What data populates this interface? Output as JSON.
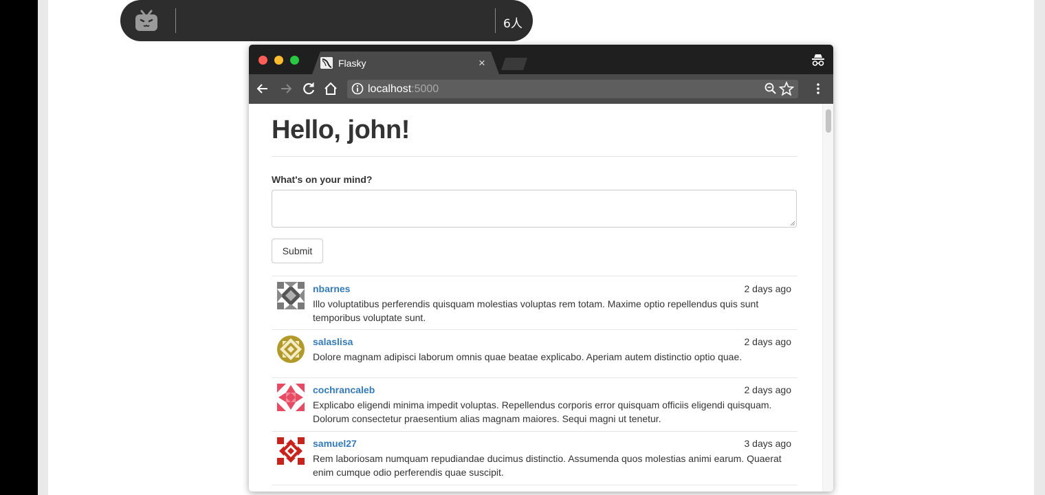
{
  "overlay": {
    "viewer_count": "6人"
  },
  "browser": {
    "tab_title": "Flasky",
    "tab_close": "×",
    "url_host": "localhost",
    "url_port": ":5000"
  },
  "page": {
    "greeting": "Hello, john!",
    "form_label": "What's on your mind?",
    "textarea_value": "",
    "submit_label": "Submit"
  },
  "posts": [
    {
      "author": "nbarnes",
      "date": "2 days ago",
      "body": "Illo voluptatibus perferendis quisquam molestias voluptas rem totam. Maxime optio repellendus quis sunt temporibus voluptate sunt.",
      "avatar_color": "#6b6b6b"
    },
    {
      "author": "salaslisa",
      "date": "2 days ago",
      "body": "Dolore magnam adipisci laborum omnis quae beatae explicabo. Aperiam autem distinctio optio quae.",
      "avatar_color": "#b19a2a"
    },
    {
      "author": "cochrancaleb",
      "date": "2 days ago",
      "body": "Explicabo eligendi minima impedit voluptas. Repellendus corporis error quisquam officiis eligendi quisquam. Dolorum consectetur praesentium alias magnam maiores. Sequi magni ut tenetur.",
      "avatar_color": "#e64b63"
    },
    {
      "author": "samuel27",
      "date": "3 days ago",
      "body": "Rem laboriosam numquam repudiandae ducimus distinctio. Assumenda quos molestias animi earum. Quaerat enim cumque odio perferendis quae suscipit.",
      "avatar_color": "#c8221c"
    }
  ],
  "colors": {
    "link": "#337ab7",
    "titlebar": "#1f1f1f",
    "toolbar": "#4a4a4a",
    "traffic_red": "#ff5f57",
    "traffic_yellow": "#febc2e",
    "traffic_green": "#28c840"
  },
  "icons": [
    "bilibili-tv-icon",
    "flask-favicon-icon",
    "incognito-icon",
    "back-arrow-icon",
    "forward-arrow-icon",
    "reload-icon",
    "home-icon",
    "info-icon",
    "zoom-icon",
    "star-icon",
    "menu-dots-icon"
  ]
}
